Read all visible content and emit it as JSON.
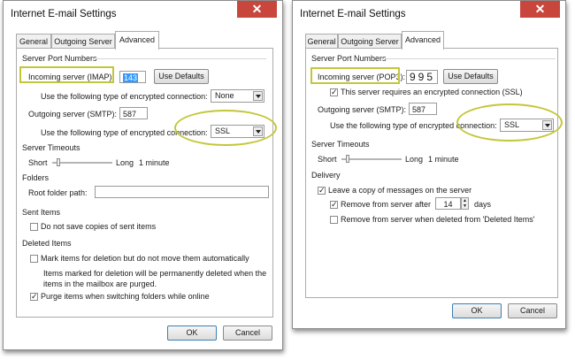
{
  "imap_dialog": {
    "title": "Internet E-mail Settings",
    "close_label": "✕",
    "tabs": [
      "General",
      "Outgoing Server",
      "Advanced"
    ],
    "server_port_numbers": "Server Port Numbers",
    "incoming_label": "Incoming server (IMAP):",
    "incoming_value": "143",
    "use_defaults": "Use Defaults",
    "incoming_enc_label": "Use the following type of encrypted connection:",
    "incoming_enc_value": "None",
    "outgoing_label": "Outgoing server (SMTP):",
    "outgoing_value": "587",
    "outgoing_enc_label": "Use the following type of encrypted connection:",
    "outgoing_enc_value": "SSL",
    "server_timeouts": "Server Timeouts",
    "short": "Short",
    "long": "Long",
    "timeout_value": "1 minute",
    "folders": "Folders",
    "root_folder_label": "Root folder path:",
    "root_folder_value": "",
    "sent_items": "Sent Items",
    "no_save_sent": "Do not save copies of sent items",
    "deleted_items": "Deleted Items",
    "mark_delete": "Mark items for deletion but do not move them automatically",
    "mark_delete_note_1": "Items marked for deletion will be permanently deleted when the",
    "mark_delete_note_2": "items in the mailbox are purged.",
    "purge": "Purge items when switching folders while online",
    "check_mark": "✓",
    "ok": "OK",
    "cancel": "Cancel"
  },
  "pop3_dialog": {
    "title": "Internet E-mail Settings",
    "close_label": "✕",
    "tabs": [
      "General",
      "Outgoing Server",
      "Advanced"
    ],
    "server_port_numbers": "Server Port Numbers",
    "incoming_label": "Incoming server (POP3):",
    "incoming_value": "995",
    "use_defaults": "Use Defaults",
    "ssl_required": "This server requires an encrypted connection (SSL)",
    "outgoing_label": "Outgoing server (SMTP):",
    "outgoing_value": "587",
    "outgoing_enc_label": "Use the following type of encrypted connection:",
    "outgoing_enc_value": "SSL",
    "server_timeouts": "Server Timeouts",
    "short": "Short",
    "long": "Long",
    "timeout_value": "1 minute",
    "delivery": "Delivery",
    "leave_copy": "Leave a copy of messages on the server",
    "remove_after": "Remove from server after",
    "remove_after_days": "14",
    "days": "days",
    "remove_when_deleted": "Remove from server when deleted from 'Deleted Items'",
    "check_mark": "✓",
    "ok": "OK",
    "cancel": "Cancel"
  },
  "colors": {
    "annotation": "#c4c63a",
    "close_button": "#c9463d",
    "selection": "#3399ff"
  }
}
